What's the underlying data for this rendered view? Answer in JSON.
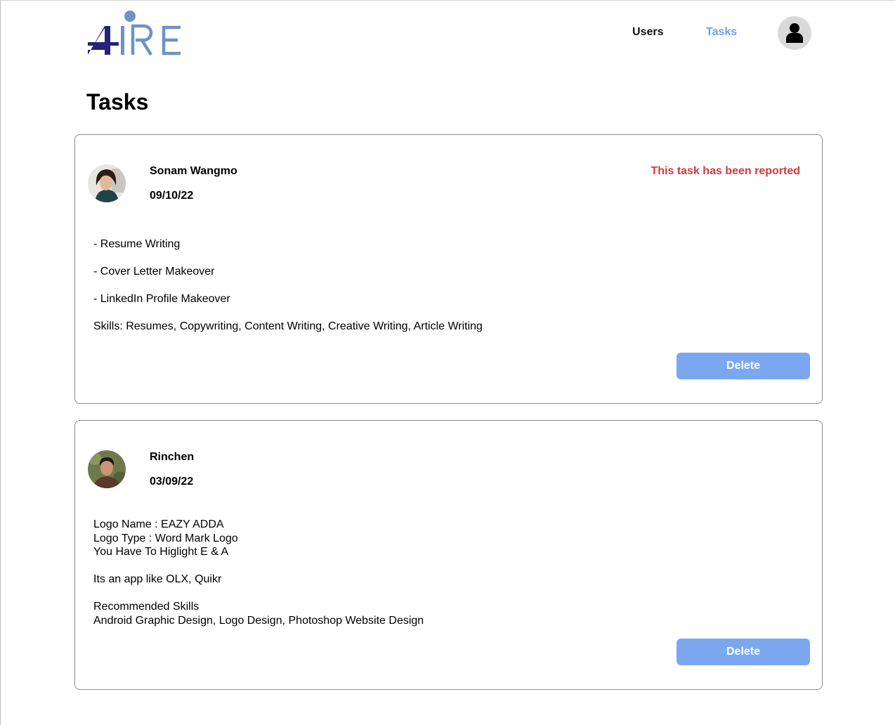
{
  "header": {
    "nav": {
      "users_label": "Users",
      "tasks_label": "Tasks"
    },
    "account_icon": "person-icon",
    "brand": {
      "dark": "#28227a",
      "light": "#6b93c7"
    }
  },
  "page": {
    "title": "Tasks"
  },
  "tasks": [
    {
      "name": "Sonam Wangmo",
      "date": "09/10/22",
      "status": "This task has been reported",
      "lines": [
        "- Resume Writing",
        "- Cover Letter Makeover",
        "- LinkedIn Profile Makeover",
        "Skills: Resumes, Copywriting, Content Writing, Creative Writing, Article Writing"
      ],
      "delete_label": "Delete"
    },
    {
      "name": "Rinchen",
      "date": "03/09/22",
      "description": "Logo Name : EAZY ADDA\nLogo Type : Word Mark Logo\nYou Have To Higlight E & A\n\nIts an app like OLX, Quikr\n\nRecommended Skills\nAndroid Graphic Design, Logo Design, Photoshop Website Design",
      "delete_label": "Delete"
    }
  ],
  "colors": {
    "accent": "#7aa7f0",
    "active_nav": "#6f9ee8",
    "reported": "#d4383f"
  }
}
